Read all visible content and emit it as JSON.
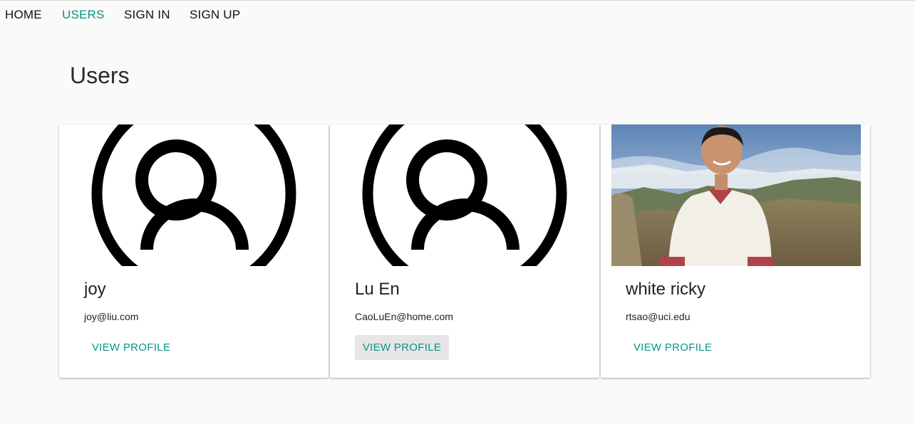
{
  "nav": {
    "items": [
      {
        "label": "HOME",
        "active": false
      },
      {
        "label": "USERS",
        "active": true
      },
      {
        "label": "SIGN IN",
        "active": false
      },
      {
        "label": "SIGN UP",
        "active": false
      }
    ]
  },
  "page": {
    "title": "Users"
  },
  "colors": {
    "accent": "#0a9383",
    "background": "#fafafa",
    "button_hover": "#e6e6e6"
  },
  "users": [
    {
      "name": "joy",
      "email": "joy@liu.com",
      "button_label": "VIEW PROFILE",
      "avatar": "default-avatar-icon"
    },
    {
      "name": "Lu En",
      "email": "CaoLuEn@home.com",
      "button_label": "VIEW PROFILE",
      "avatar": "default-avatar-icon"
    },
    {
      "name": "white ricky",
      "email": "rtsao@uci.edu",
      "button_label": "VIEW PROFILE",
      "avatar": "profile-photo"
    }
  ]
}
